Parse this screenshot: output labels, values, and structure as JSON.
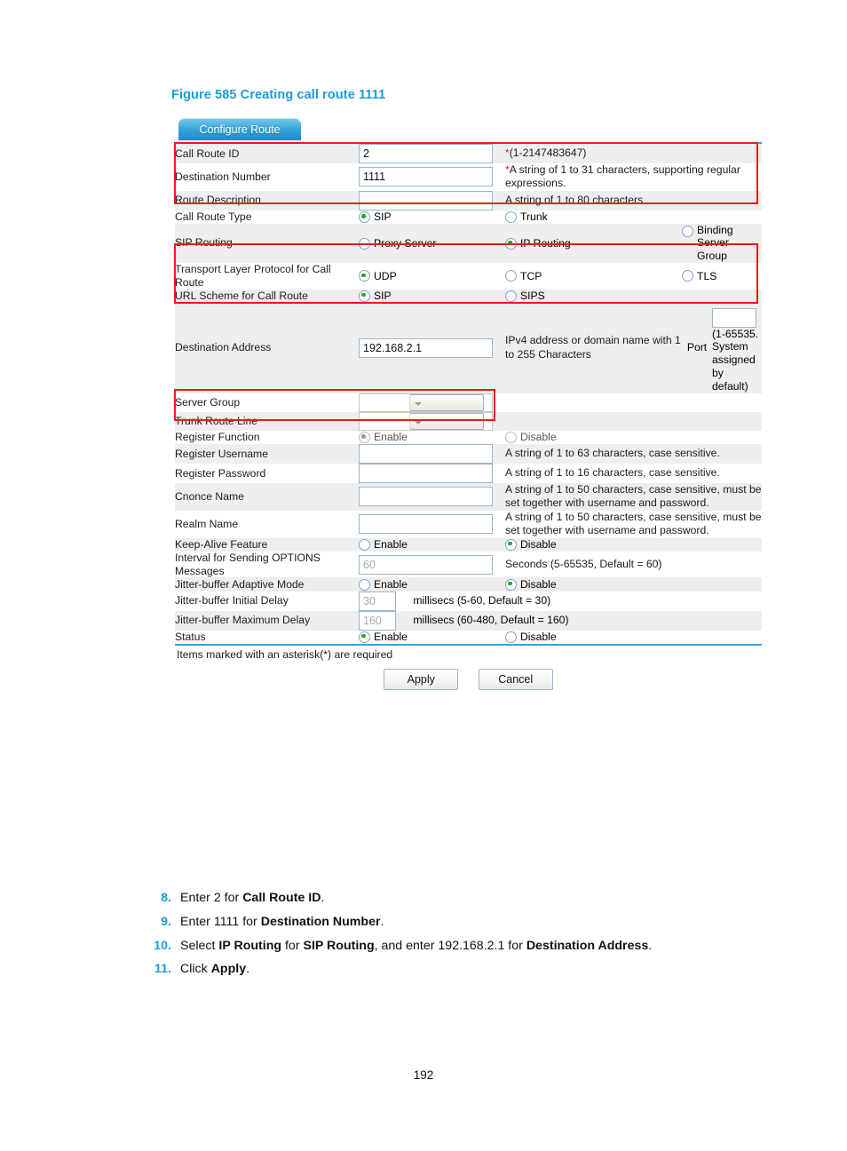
{
  "figure": {
    "caption": "Figure 585 Creating call route 1111",
    "caption_color": "#1b9dd9"
  },
  "panel": {
    "tab": {
      "label": "Configure Route"
    },
    "rows": [
      {
        "label": "Call Route ID",
        "control": {
          "type": "text",
          "value": "2"
        },
        "hint": "*(1-2147483647)",
        "hint_star": true
      },
      {
        "label": "Destination Number",
        "control": {
          "type": "text",
          "value": "1111"
        },
        "hint": "*A string of 1 to 31 characters, supporting regular expressions.",
        "hint_star": true
      },
      {
        "label": "Route Description",
        "control": {
          "type": "text",
          "value": ""
        },
        "hint": "A string of 1 to 80 characters"
      },
      {
        "label": "Call Route Type",
        "radios": [
          {
            "label": "SIP",
            "selected": true
          },
          {
            "label": "Trunk",
            "selected": false
          }
        ]
      },
      {
        "label": "SIP Routing",
        "radios": [
          {
            "label": "Proxy Server",
            "selected": false
          },
          {
            "label": "IP Routing",
            "selected": true
          },
          {
            "label": "Binding Server Group",
            "selected": false
          }
        ]
      },
      {
        "label": "Transport Layer Protocol for Call Route",
        "radios": [
          {
            "label": "UDP",
            "selected": true
          },
          {
            "label": "TCP",
            "selected": false
          },
          {
            "label": "TLS",
            "selected": false
          }
        ]
      },
      {
        "label": "URL Scheme for Call Route",
        "radios": [
          {
            "label": "SIP",
            "selected": true
          },
          {
            "label": "SIPS",
            "selected": false
          }
        ]
      }
    ],
    "destination_block": {
      "label": "Destination Address",
      "value": "192.168.2.1",
      "hint": "IPv4 address or domain name with 1 to 255 Characters",
      "port_label": "Port",
      "port_value": "",
      "port_hint": "(1-65535. System assigned by default)"
    },
    "rows2": [
      {
        "label": "Server Group",
        "control": {
          "type": "select",
          "value": ""
        },
        "hint": ""
      },
      {
        "label": "Trunk Route Line",
        "control": {
          "type": "select",
          "value": ""
        },
        "hint": ""
      },
      {
        "label": "Register Function",
        "disabled": true,
        "radios": [
          {
            "label": "Enable",
            "selected": true
          },
          {
            "label": "Disable",
            "selected": false
          }
        ]
      },
      {
        "label": "Register Username",
        "control": {
          "type": "text",
          "value": ""
        },
        "hint": "A string of 1 to 63 characters, case sensitive."
      },
      {
        "label": "Register Password",
        "control": {
          "type": "text",
          "value": ""
        },
        "hint": "A string of 1 to 16 characters, case sensitive."
      },
      {
        "label": "Cnonce Name",
        "control": {
          "type": "text",
          "value": ""
        },
        "hint": "A string of 1 to 50 characters, case sensitive, must be set together with username and password."
      },
      {
        "label": "Realm Name",
        "control": {
          "type": "text",
          "value": ""
        },
        "hint": "A string of 1 to 50 characters, case sensitive, must be set together with username and password."
      },
      {
        "label": "Keep-Alive Feature",
        "radios": [
          {
            "label": "Enable",
            "selected": false
          },
          {
            "label": "Disable",
            "selected": true
          }
        ]
      },
      {
        "label": "Interval for Sending OPTIONS Messages",
        "control": {
          "type": "text",
          "value": "60",
          "placeholder_style": true
        },
        "hint": "Seconds (5-65535, Default = 60)"
      },
      {
        "label": "Jitter-buffer Adaptive Mode",
        "radios": [
          {
            "label": "Enable",
            "selected": false
          },
          {
            "label": "Disable",
            "selected": true
          }
        ]
      },
      {
        "label": "Jitter-buffer Initial Delay",
        "control": {
          "type": "text-small",
          "value": "30",
          "placeholder_style": true
        },
        "hint": "millisecs (5-60, Default = 30)"
      },
      {
        "label": "Jitter-buffer Maximum Delay",
        "control": {
          "type": "text-small",
          "value": "160",
          "placeholder_style": true
        },
        "hint": "millisecs (60-480, Default = 160)"
      },
      {
        "label": "Status",
        "radios": [
          {
            "label": "Enable",
            "selected": true
          },
          {
            "label": "Disable",
            "selected": false
          }
        ]
      }
    ],
    "footnote": "Items marked with an asterisk(*) are required",
    "buttons": {
      "apply": "Apply",
      "cancel": "Cancel"
    },
    "highlight_color": "#ee1c17"
  },
  "steps": [
    {
      "num": "8.",
      "text": "Enter 2 for ",
      "bold": "Call Route ID",
      "tail": "."
    },
    {
      "num": "9.",
      "text": "Enter 1111 for ",
      "bold": "Destination Number",
      "tail": "."
    },
    {
      "num": "10.",
      "text": "Select ",
      "bold": "IP Routing",
      "mid": " for ",
      "bold2": "SIP Routing",
      "mid2": ", and enter 192.168.2.1 for ",
      "bold3": "Destination Address",
      "tail": "."
    },
    {
      "num": "11.",
      "text": "Click ",
      "bold": "Apply",
      "tail": "."
    }
  ],
  "page_number": "192"
}
